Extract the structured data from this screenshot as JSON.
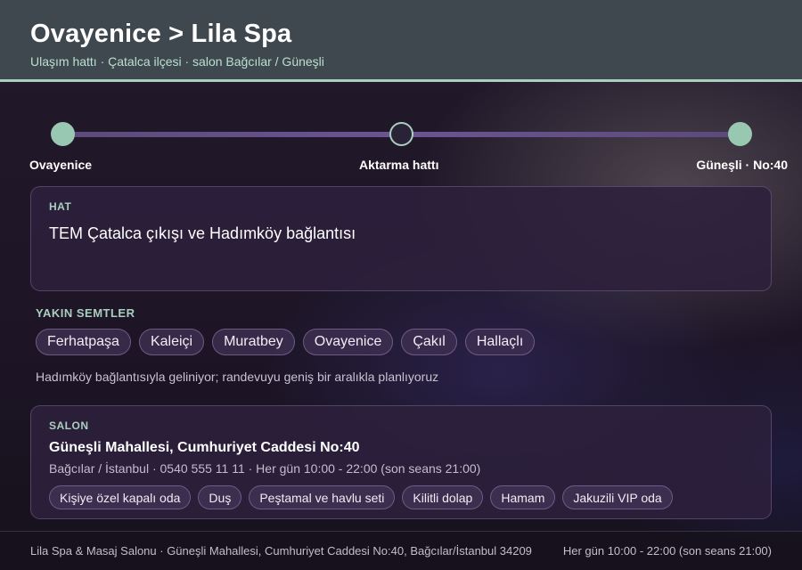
{
  "header": {
    "title": "Ovayenice > Lila Spa",
    "subtitle": "Ulaşım hattı · Çatalca ilçesi · salon Bağcılar / Güneşli"
  },
  "route": {
    "stops": [
      {
        "label": "Ovayenice",
        "state": "filled"
      },
      {
        "label": "Aktarma hattı",
        "state": "hollow"
      },
      {
        "label": "Güneşli · No:40",
        "state": "filled"
      }
    ]
  },
  "line_card": {
    "label": "HAT",
    "value": "TEM Çatalca çıkışı ve Hadımköy bağlantısı"
  },
  "nearby": {
    "label": "YAKIN SEMTLER",
    "items": [
      "Ferhatpaşa",
      "Kaleiçi",
      "Muratbey",
      "Ovayenice",
      "Çakıl",
      "Hallaçlı"
    ],
    "note": "Hadımköy bağlantısıyla geliniyor; randevuyu geniş bir aralıkla planlıyoruz"
  },
  "salon": {
    "label": "SALON",
    "address": "Güneşli Mahallesi, Cumhuriyet Caddesi No:40",
    "meta": "Bağcılar / İstanbul · 0540 555 11 11 · Her gün 10:00 - 22:00 (son seans 21:00)",
    "amenities": [
      "Kişiye özel kapalı oda",
      "Duş",
      "Peştamal ve havlu seti",
      "Kilitli dolap",
      "Hamam",
      "Jakuzili VIP oda"
    ]
  },
  "footer": {
    "left": "Lila Spa & Masaj Salonu · Güneşli Mahallesi, Cumhuriyet Caddesi No:40, Bağcılar/İstanbul 34209",
    "right": "Her gün 10:00 - 22:00 (son seans 21:00)"
  },
  "colors": {
    "accent": "#a9cfbf",
    "header_bg": "#3f474f",
    "route_line": "#6b5592"
  }
}
